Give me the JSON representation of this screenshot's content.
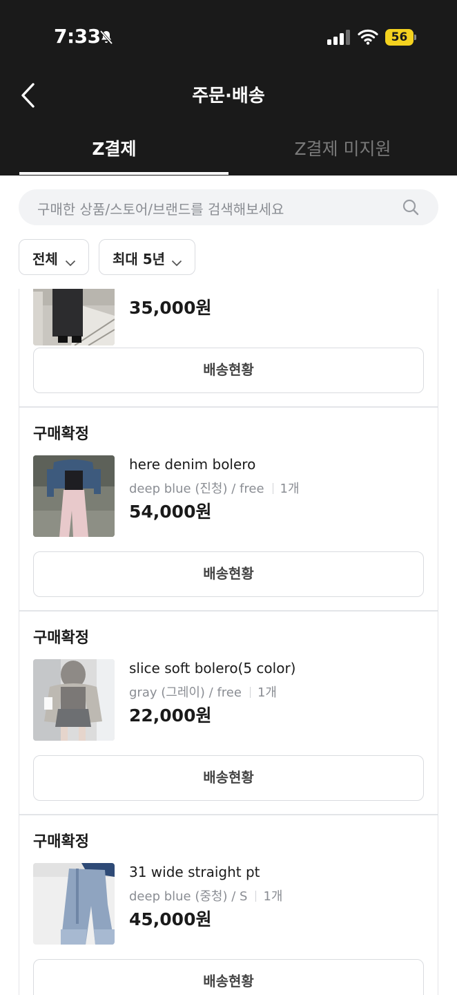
{
  "status_bar": {
    "time": "7:33",
    "battery": "56",
    "icons": [
      "bell-slash-icon",
      "signal-icon",
      "wifi-icon",
      "battery-icon"
    ]
  },
  "header": {
    "title": "주문·배송",
    "back_icon": "chevron-left-icon"
  },
  "tabs": [
    {
      "label": "Z결제",
      "active": true
    },
    {
      "label": "Z결제 미지원",
      "active": false
    }
  ],
  "search": {
    "placeholder": "구매한 상품/스토어/브랜드를 검색해보세요",
    "icon": "search-icon"
  },
  "filters": [
    {
      "label": "전체"
    },
    {
      "label": "최대 5년"
    }
  ],
  "orders": [
    {
      "status": "",
      "name": "",
      "option": "",
      "qty": "",
      "price": "35,000원",
      "button": "배송현황"
    },
    {
      "status": "구매확정",
      "name": "here denim bolero",
      "option": "deep blue (진청) / free",
      "qty": "1개",
      "price": "54,000원",
      "button": "배송현황"
    },
    {
      "status": "구매확정",
      "name": "slice soft bolero(5 color)",
      "option": "gray (그레이) / free",
      "qty": "1개",
      "price": "22,000원",
      "button": "배송현황"
    },
    {
      "status": "구매확정",
      "name": "31 wide straight pt",
      "option": "deep blue (중청) / S",
      "qty": "1개",
      "price": "45,000원",
      "button": "배송현황"
    }
  ],
  "colors": {
    "header_bg": "#1a1a1a",
    "battery": "#f4d21f",
    "muted_text": "#8a8d93",
    "border": "#d9dbdf"
  }
}
